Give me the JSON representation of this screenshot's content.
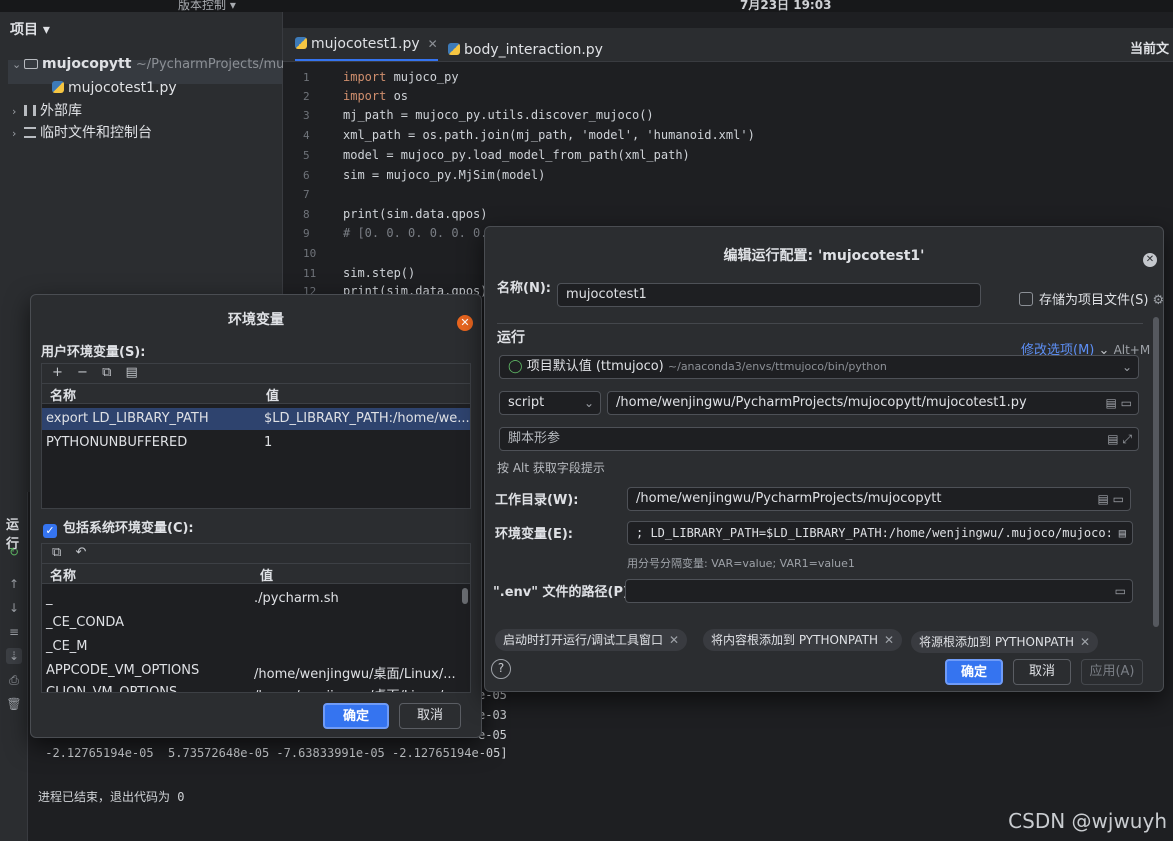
{
  "top": {
    "clock": "7月23日 19:03",
    "vcs_menu": "版本控制 ▾"
  },
  "project_panel": {
    "title": "项目 ▾",
    "root_name": "mujocopytt",
    "root_path": "~/PycharmProjects/mu",
    "file": "mujocotest1.py",
    "external_libs": "外部库",
    "scratches": "临时文件和控制台"
  },
  "editor": {
    "tabs": [
      {
        "label": "mujocotest1.py"
      },
      {
        "label": "body_interaction.py"
      }
    ],
    "right_label": "当前文",
    "lines": [
      {
        "n": "1",
        "text": "mujoco_py",
        "kw": "import "
      },
      {
        "n": "2",
        "text": "os",
        "kw": "import "
      },
      {
        "n": "3",
        "text": "mj_path = mujoco_py.utils.discover_mujoco()",
        "kw": ""
      },
      {
        "n": "4",
        "text": "xml_path = os.path.join(mj_path, 'model', 'humanoid.xml')",
        "kw": ""
      },
      {
        "n": "5",
        "text": "model = mujoco_py.load_model_from_path(xml_path)",
        "kw": ""
      },
      {
        "n": "6",
        "text": "sim = mujoco_py.MjSim(model)",
        "kw": ""
      },
      {
        "n": "7",
        "text": "",
        "kw": ""
      },
      {
        "n": "8",
        "text": "print(sim.data.qpos)",
        "kw": ""
      },
      {
        "n": "9",
        "text": "# [0. 0. 0. 0. 0. 0.",
        "kw": ""
      },
      {
        "n": "10",
        "text": "",
        "kw": ""
      },
      {
        "n": "11",
        "text": "sim.step()",
        "kw": ""
      },
      {
        "n": "12",
        "text": "print(sim.data.qpos)",
        "kw": ""
      }
    ]
  },
  "run": {
    "label": "运行",
    "output_lines": [
      "e-05",
      "e-03",
      "e-05",
      " -2.12765194e-05  5.73572648e-05 -7.63833991e-05 -2.12765194e-05]",
      "进程已结束，退出代码为 0"
    ]
  },
  "env_dialog": {
    "title": "环境变量",
    "user_section": "用户环境变量(S):",
    "col_name": "名称",
    "col_value": "值",
    "user_vars": [
      {
        "name": "export LD_LIBRARY_PATH",
        "value": "$LD_LIBRARY_PATH:/home/we..."
      },
      {
        "name": "PYTHONUNBUFFERED",
        "value": "1"
      }
    ],
    "include_system": "包括系统环境变量(C):",
    "system_vars": [
      {
        "name": "_",
        "value": "./pycharm.sh"
      },
      {
        "name": "_CE_CONDA",
        "value": ""
      },
      {
        "name": "_CE_M",
        "value": ""
      },
      {
        "name": "APPCODE_VM_OPTIONS",
        "value": "/home/wenjingwu/桌面/Linux/..."
      },
      {
        "name": "CLION_VM_OPTIONS",
        "value": "/home/wenjingwu/桌面/Linux/..."
      }
    ],
    "ok": "确定",
    "cancel": "取消"
  },
  "config_dialog": {
    "title": "编辑运行配置: 'mujocotest1'",
    "name_label": "名称(N):",
    "name_value": "mujocotest1",
    "store_as_file": "存储为项目文件(S)",
    "run_section": "运行",
    "modify_options": "修改选项(M)",
    "modify_shortcut": "Alt+M",
    "interpreter": "项目默认值 (ttmujoco)",
    "interpreter_path": "~/anaconda3/envs/ttmujoco/bin/python",
    "script_type": "script",
    "script_path": "/home/wenjingwu/PycharmProjects/mujocopytt/mujocotest1.py",
    "script_params_placeholder": "脚本形参",
    "alt_hint": "按 Alt 获取字段提示",
    "workdir_label": "工作目录(W):",
    "workdir_value": "/home/wenjingwu/PycharmProjects/mujocopytt",
    "env_label": "环境变量(E):",
    "env_value": "; LD_LIBRARY_PATH=$LD_LIBRARY_PATH:/home/wenjingwu/.mujoco/mujoco:",
    "env_hint": "用分号分隔变量: VAR=value; VAR1=value1",
    "dotenv_label": "\".env\" 文件的路径(P):",
    "chips": [
      "启动时打开运行/调试工具窗口",
      "将内容根添加到 PYTHONPATH",
      "将源根添加到 PYTHONPATH"
    ],
    "ok": "确定",
    "cancel": "取消",
    "apply": "应用(A)"
  },
  "watermark": "CSDN @wjwuyh"
}
